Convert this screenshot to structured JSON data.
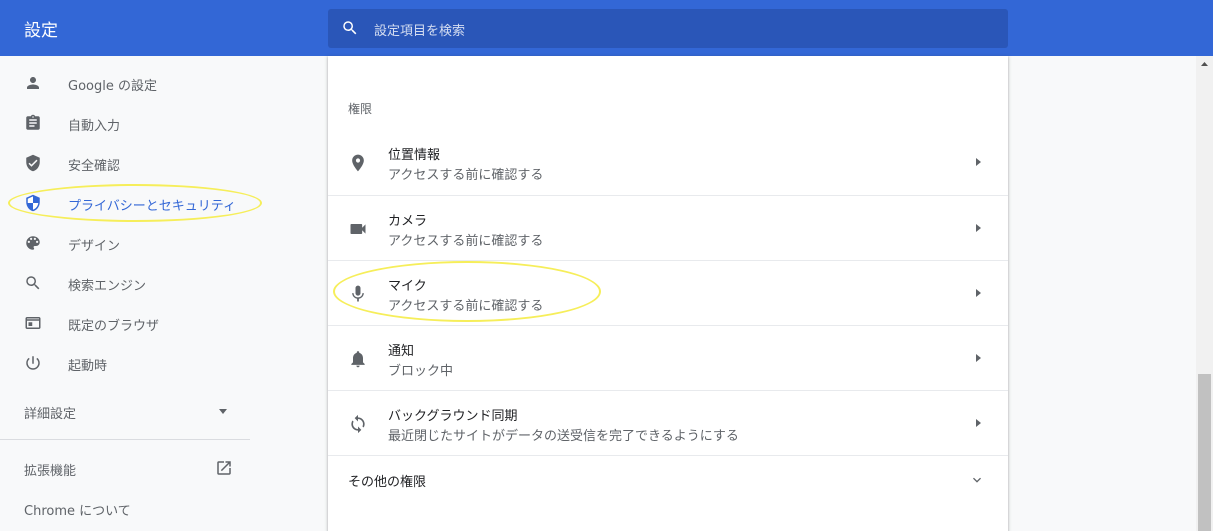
{
  "header": {
    "title": "設定",
    "search_placeholder": "設定項目を検索"
  },
  "sidebar": {
    "items": [
      {
        "label": "Google の設定",
        "icon": "person-icon"
      },
      {
        "label": "自動入力",
        "icon": "clipboard-icon"
      },
      {
        "label": "安全確認",
        "icon": "shield-check-icon"
      },
      {
        "label": "プライバシーとセキュリティ",
        "icon": "shield-privacy-icon",
        "active": true
      },
      {
        "label": "デザイン",
        "icon": "palette-icon"
      },
      {
        "label": "検索エンジン",
        "icon": "search-icon"
      },
      {
        "label": "既定のブラウザ",
        "icon": "browser-icon"
      },
      {
        "label": "起動時",
        "icon": "power-icon"
      }
    ],
    "advanced_label": "詳細設定",
    "extensions_label": "拡張機能",
    "about_label": "Chrome について"
  },
  "main": {
    "section_title": "権限",
    "rows": [
      {
        "title": "位置情報",
        "subtitle": "アクセスする前に確認する",
        "icon": "location-pin-icon"
      },
      {
        "title": "カメラ",
        "subtitle": "アクセスする前に確認する",
        "icon": "camera-icon"
      },
      {
        "title": "マイク",
        "subtitle": "アクセスする前に確認する",
        "icon": "microphone-icon"
      },
      {
        "title": "通知",
        "subtitle": "ブロック中",
        "icon": "bell-icon"
      },
      {
        "title": "バックグラウンド同期",
        "subtitle": "最近閉じたサイトがデータの送受信を完了できるようにする",
        "icon": "sync-icon"
      }
    ],
    "more_label": "その他の権限"
  },
  "colors": {
    "header_bg": "#3367d6",
    "search_bg": "#2a56b8",
    "active_nav": "#3367d6",
    "highlight": "#f6ee5a"
  }
}
